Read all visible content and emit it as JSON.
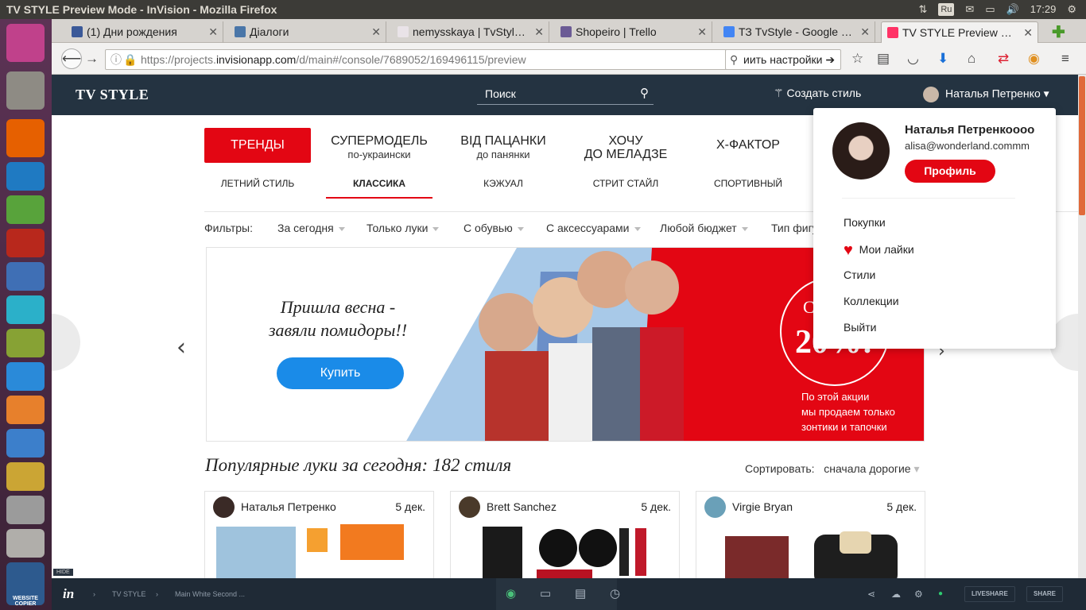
{
  "os": {
    "window_title": "TV STYLE Preview Mode - InVision - Mozilla Firefox",
    "keyboard_layout": "Ru",
    "clock": "17:29"
  },
  "browser": {
    "tabs": [
      {
        "label": "(1) Дни рождения",
        "icon": "facebook-icon",
        "color": "#3b5998"
      },
      {
        "label": "Діалоги",
        "icon": "chat-icon",
        "color": "#4a76a8"
      },
      {
        "label": "nemysskaya | TvStyl…",
        "icon": "slack-icon",
        "color": "#e9e3e8"
      },
      {
        "label": "Shopeiro | Trello",
        "icon": "trello-icon",
        "color": "#6b5b95"
      },
      {
        "label": "ТЗ TvStyle - Google …",
        "icon": "docs-icon",
        "color": "#4285f4"
      },
      {
        "label": "TV STYLE Preview …",
        "icon": "invision-icon",
        "color": "#ff3366"
      }
    ],
    "url_host": "https://projects.",
    "url_domain": "invisionapp.com",
    "url_path": "/d/main#/console/7689052/169496115/preview",
    "search_value": "иить настройки ➔"
  },
  "site": {
    "logo": "TV STYLE",
    "search_placeholder": "Поиск",
    "create_style": "Создать стиль",
    "user_name": "Наталья Петренко",
    "categories": [
      {
        "title": "ТРЕНДЫ",
        "sub": ""
      },
      {
        "title": "СУПЕРМОДЕЛЬ",
        "sub": "по-украински"
      },
      {
        "title": "ВІД ПАЦАНКИ",
        "sub": "до панянки"
      },
      {
        "title": "ХОЧУ",
        "sub": "ДО МЕЛАДЗЕ"
      },
      {
        "title": "Х-ФАКТОР",
        "sub": ""
      }
    ],
    "subcategories": [
      "ЛЕТНИЙ СТИЛЬ",
      "КЛАССИКА",
      "КЭЖУАЛ",
      "СТРИТ СТАЙЛ",
      "СПОРТИВНЫЙ"
    ],
    "filters_label": "Фильтры:",
    "filters": [
      "За сегодня",
      "Только луки",
      "С обувью",
      "С аксессуарами",
      "Любой бюджет",
      "Тип фигу"
    ],
    "banner": {
      "slogan_line1": "Пришла весна -",
      "slogan_line2": "завяли помидоры!!",
      "buy_label": "Купить",
      "promo_big": "20%!",
      "promo_top": "С",
      "promo_text1": "По этой акции",
      "promo_text2": "мы продаем только",
      "promo_text3": "зонтики и тапочки"
    },
    "popular_title": "Популярные луки за сегодня: 182 стиля",
    "sort_label": "Сортировать:",
    "sort_value": "сначала дорогие",
    "cards": [
      {
        "author": "Наталья  Петренко",
        "date": "5 дек."
      },
      {
        "author": "Brett Sanchez",
        "date": "5 дек."
      },
      {
        "author": "Virgie Bryan",
        "date": "5 дек."
      }
    ]
  },
  "dropdown": {
    "name": "Наталья Петренкоооо",
    "email": "alisa@wonderland.commm",
    "profile_button": "Профиль",
    "items": [
      "Покупки",
      "Мои лайки",
      "Стили",
      "Коллекции",
      "Выйти"
    ]
  },
  "invision": {
    "hide": "HIDE",
    "logo": "in",
    "crumb1": "TV STYLE",
    "crumb2": "Main White Second ...",
    "liveshare": "LIVESHARE",
    "share": "SHARE",
    "launcher_label": "WEBSITE COPIER"
  },
  "colors": {
    "accent_red": "#e30613",
    "header": "#243341",
    "buy_blue": "#1a8be8"
  }
}
